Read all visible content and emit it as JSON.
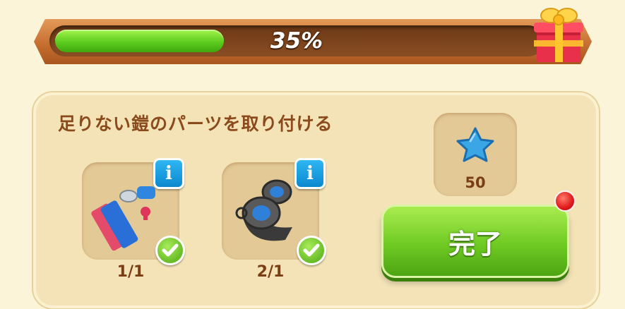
{
  "progress": {
    "label": "35%",
    "fraction": 0.35,
    "fill_color": "#5ccc1e",
    "reward_icon": "gift-box-icon"
  },
  "task": {
    "title": "足りない鎧のパーツを取り付ける",
    "items": [
      {
        "icon": "glue-and-tools-icon",
        "count": "1/1",
        "info_label": "i",
        "completed": true
      },
      {
        "icon": "tape-roll-icon",
        "count": "2/1",
        "info_label": "i",
        "completed": true
      }
    ],
    "reward": {
      "icon": "blue-star-icon",
      "value": "50"
    },
    "complete_button": {
      "label": "完了",
      "color": "#6fca23"
    },
    "notification_color": "#e0191b"
  }
}
